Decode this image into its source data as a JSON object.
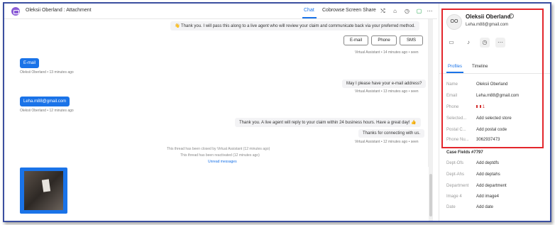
{
  "header": {
    "title": "Oleksii Oberland  : Attachment",
    "tabs": [
      "Chat",
      "Cobrowse",
      "Screen Share"
    ]
  },
  "messages": {
    "va_message_1": "👋 Thank you. I will pass this along to a live agent who will review your claim and communicate back via your preferred method.",
    "chips": [
      "E-mail",
      "Phone",
      "SMS"
    ],
    "va_meta_1": "Virtual Assistant  •  14 minutes ago  •  seen",
    "user_bubble_1": "E-mail",
    "user_meta_1": "Oleksii Oberland  •  13 minutes ago",
    "va_message_2": "May I please have your e-mail address?",
    "va_meta_2": "Virtual Assistant  •  13 minutes ago  •  seen",
    "user_bubble_2": "Leha.m88@gmail.com",
    "user_meta_2": "Oleksii Oberland  •  12 minutes ago",
    "va_message_3": "Thank you. A live agent will reply to your claim within 24 business hours. Have a great day! 👍",
    "va_message_4": "Thanks for connecting with us.",
    "va_meta_3": "Virtual Assistant  •  12 minutes ago  •  seen",
    "system_note_1": "This thread has been closed by Virtual Assistant (12 minutes ago)",
    "system_note_2": "This thread has been reactivated (12 minutes ago)",
    "unread": "Unread messages"
  },
  "customer": {
    "initials": "OO",
    "name": "Oleksii Oberland",
    "email": "Leha.m88@gmail.com",
    "tabs": [
      "Profiles",
      "Timeline"
    ],
    "fields": [
      {
        "label": "Name",
        "value": "Oleksii Oberland"
      },
      {
        "label": "Email",
        "value": "Leha.m88@gmail.com"
      },
      {
        "label": "Phone",
        "value": "1"
      },
      {
        "label": "Selected...",
        "value": "Add selected store"
      },
      {
        "label": "Postal C...",
        "value": "Add postal code"
      },
      {
        "label": "Phone Nu...",
        "value": "3062937473"
      }
    ]
  },
  "case": {
    "title": "Case Fields #7797",
    "fields": [
      {
        "label": "Dept-Ofs",
        "value": "Add deptdfs"
      },
      {
        "label": "Dept-Ahs",
        "value": "Add deptahs"
      },
      {
        "label": "Department",
        "value": "Add department"
      },
      {
        "label": "Image 4",
        "value": "Add image4"
      },
      {
        "label": "Date",
        "value": "Add date"
      }
    ]
  },
  "colors": {
    "accent": "#1a73e8",
    "highlight": "#e3262c"
  }
}
